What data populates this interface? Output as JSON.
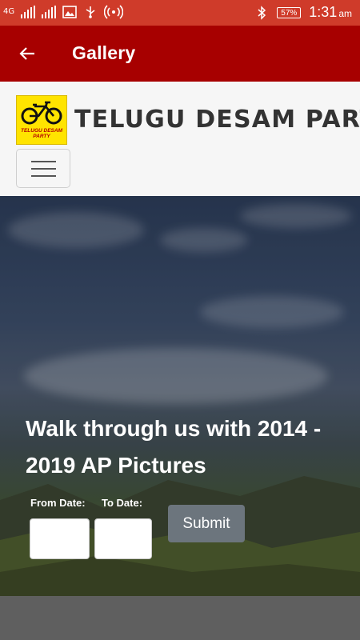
{
  "status_bar": {
    "network": "4G",
    "battery": "57%",
    "time": "1:31",
    "ampm": "am",
    "icons": [
      "signal-icon",
      "signal-icon",
      "image-icon",
      "usb-icon",
      "hotspot-icon",
      "bluetooth-icon",
      "battery-icon"
    ]
  },
  "app_bar": {
    "title": "Gallery",
    "back_icon": "arrow-back-icon",
    "color": "#a70000"
  },
  "site_header": {
    "brand": "TELUGU DESAM PARTY",
    "logo_text": "TELUGU DESAM PARTY",
    "menu_icon": "hamburger-icon"
  },
  "hero": {
    "heading": "Walk through us with 2014 - 2019 AP Pictures",
    "from_label": "From Date:",
    "to_label": "To Date:",
    "from_value": "",
    "to_value": "",
    "submit_label": "Submit"
  },
  "colors": {
    "status_bar": "#cf3b2a",
    "app_bar": "#a70000",
    "submit": "#6c757d"
  }
}
